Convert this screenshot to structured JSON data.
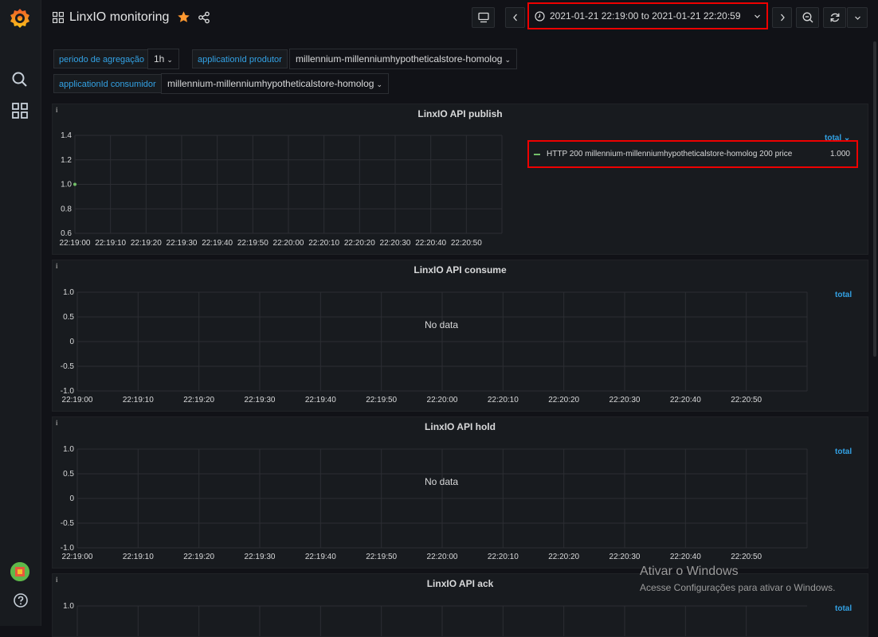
{
  "dashboard": {
    "title": "LinxIO monitoring"
  },
  "timepicker": {
    "range": "2021-01-21 22:19:00 to 2021-01-21 22:20:59"
  },
  "variables": [
    {
      "label": "periodo de agregação",
      "value": "1h"
    },
    {
      "label": "applicationId produtor",
      "value": "millennium-millenniumhypotheticalstore-homolog"
    },
    {
      "label": "applicationId consumidor",
      "value": "millennium-millenniumhypotheticalstore-homolog"
    }
  ],
  "panels": [
    {
      "title": "LinxIO API publish",
      "y_ticks": [
        "1.4",
        "1.2",
        "1.0",
        "0.8",
        "0.6"
      ],
      "x_ticks": [
        "22:19:00",
        "22:19:10",
        "22:19:20",
        "22:19:30",
        "22:19:40",
        "22:19:50",
        "22:20:00",
        "22:20:10",
        "22:20:20",
        "22:20:30",
        "22:20:40",
        "22:20:50"
      ],
      "legend_header": "total",
      "legend": [
        {
          "name": "HTTP 200 millennium-millenniumhypotheticalstore-homolog 200 price",
          "value": "1.000",
          "color": "#73bf69"
        }
      ],
      "point": {
        "x": "22:19:00",
        "y": 1.0
      }
    },
    {
      "title": "LinxIO API consume",
      "y_ticks": [
        "1.0",
        "0.5",
        "0",
        "-0.5",
        "-1.0"
      ],
      "x_ticks": [
        "22:19:00",
        "22:19:10",
        "22:19:20",
        "22:19:30",
        "22:19:40",
        "22:19:50",
        "22:20:00",
        "22:20:10",
        "22:20:20",
        "22:20:30",
        "22:20:40",
        "22:20:50"
      ],
      "legend_header": "total",
      "no_data": "No data"
    },
    {
      "title": "LinxIO API hold",
      "y_ticks": [
        "1.0",
        "0.5",
        "0",
        "-0.5",
        "-1.0"
      ],
      "x_ticks": [
        "22:19:00",
        "22:19:10",
        "22:19:20",
        "22:19:30",
        "22:19:40",
        "22:19:50",
        "22:20:00",
        "22:20:10",
        "22:20:20",
        "22:20:30",
        "22:20:40",
        "22:20:50"
      ],
      "legend_header": "total",
      "no_data": "No data"
    },
    {
      "title": "LinxIO API ack",
      "y_ticks": [
        "1.0"
      ],
      "legend_header": "total"
    }
  ],
  "watermark": {
    "title": "Ativar o Windows",
    "subtitle": "Acesse Configurações para ativar o Windows."
  },
  "colors": {
    "accent": "#33a2e5",
    "star": "#ff9830",
    "series": "#73bf69",
    "highlight": "#e00000"
  }
}
